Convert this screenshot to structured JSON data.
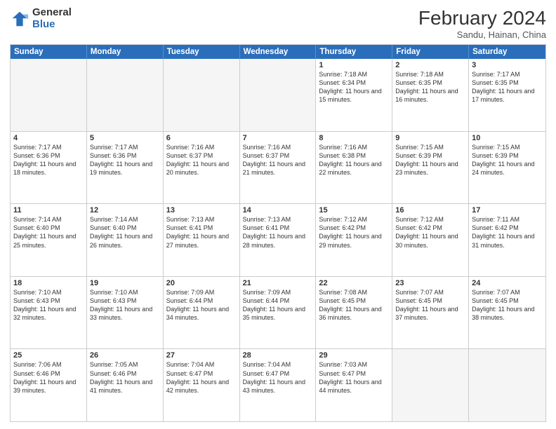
{
  "header": {
    "logo_general": "General",
    "logo_blue": "Blue",
    "month_year": "February 2024",
    "location": "Sandu, Hainan, China"
  },
  "days_of_week": [
    "Sunday",
    "Monday",
    "Tuesday",
    "Wednesday",
    "Thursday",
    "Friday",
    "Saturday"
  ],
  "weeks": [
    [
      {
        "day": "",
        "info": "",
        "empty": true
      },
      {
        "day": "",
        "info": "",
        "empty": true
      },
      {
        "day": "",
        "info": "",
        "empty": true
      },
      {
        "day": "",
        "info": "",
        "empty": true
      },
      {
        "day": "1",
        "info": "Sunrise: 7:18 AM\nSunset: 6:34 PM\nDaylight: 11 hours and 15 minutes."
      },
      {
        "day": "2",
        "info": "Sunrise: 7:18 AM\nSunset: 6:35 PM\nDaylight: 11 hours and 16 minutes."
      },
      {
        "day": "3",
        "info": "Sunrise: 7:17 AM\nSunset: 6:35 PM\nDaylight: 11 hours and 17 minutes."
      }
    ],
    [
      {
        "day": "4",
        "info": "Sunrise: 7:17 AM\nSunset: 6:36 PM\nDaylight: 11 hours and 18 minutes."
      },
      {
        "day": "5",
        "info": "Sunrise: 7:17 AM\nSunset: 6:36 PM\nDaylight: 11 hours and 19 minutes."
      },
      {
        "day": "6",
        "info": "Sunrise: 7:16 AM\nSunset: 6:37 PM\nDaylight: 11 hours and 20 minutes."
      },
      {
        "day": "7",
        "info": "Sunrise: 7:16 AM\nSunset: 6:37 PM\nDaylight: 11 hours and 21 minutes."
      },
      {
        "day": "8",
        "info": "Sunrise: 7:16 AM\nSunset: 6:38 PM\nDaylight: 11 hours and 22 minutes."
      },
      {
        "day": "9",
        "info": "Sunrise: 7:15 AM\nSunset: 6:39 PM\nDaylight: 11 hours and 23 minutes."
      },
      {
        "day": "10",
        "info": "Sunrise: 7:15 AM\nSunset: 6:39 PM\nDaylight: 11 hours and 24 minutes."
      }
    ],
    [
      {
        "day": "11",
        "info": "Sunrise: 7:14 AM\nSunset: 6:40 PM\nDaylight: 11 hours and 25 minutes."
      },
      {
        "day": "12",
        "info": "Sunrise: 7:14 AM\nSunset: 6:40 PM\nDaylight: 11 hours and 26 minutes."
      },
      {
        "day": "13",
        "info": "Sunrise: 7:13 AM\nSunset: 6:41 PM\nDaylight: 11 hours and 27 minutes."
      },
      {
        "day": "14",
        "info": "Sunrise: 7:13 AM\nSunset: 6:41 PM\nDaylight: 11 hours and 28 minutes."
      },
      {
        "day": "15",
        "info": "Sunrise: 7:12 AM\nSunset: 6:42 PM\nDaylight: 11 hours and 29 minutes."
      },
      {
        "day": "16",
        "info": "Sunrise: 7:12 AM\nSunset: 6:42 PM\nDaylight: 11 hours and 30 minutes."
      },
      {
        "day": "17",
        "info": "Sunrise: 7:11 AM\nSunset: 6:42 PM\nDaylight: 11 hours and 31 minutes."
      }
    ],
    [
      {
        "day": "18",
        "info": "Sunrise: 7:10 AM\nSunset: 6:43 PM\nDaylight: 11 hours and 32 minutes."
      },
      {
        "day": "19",
        "info": "Sunrise: 7:10 AM\nSunset: 6:43 PM\nDaylight: 11 hours and 33 minutes."
      },
      {
        "day": "20",
        "info": "Sunrise: 7:09 AM\nSunset: 6:44 PM\nDaylight: 11 hours and 34 minutes."
      },
      {
        "day": "21",
        "info": "Sunrise: 7:09 AM\nSunset: 6:44 PM\nDaylight: 11 hours and 35 minutes."
      },
      {
        "day": "22",
        "info": "Sunrise: 7:08 AM\nSunset: 6:45 PM\nDaylight: 11 hours and 36 minutes."
      },
      {
        "day": "23",
        "info": "Sunrise: 7:07 AM\nSunset: 6:45 PM\nDaylight: 11 hours and 37 minutes."
      },
      {
        "day": "24",
        "info": "Sunrise: 7:07 AM\nSunset: 6:45 PM\nDaylight: 11 hours and 38 minutes."
      }
    ],
    [
      {
        "day": "25",
        "info": "Sunrise: 7:06 AM\nSunset: 6:46 PM\nDaylight: 11 hours and 39 minutes."
      },
      {
        "day": "26",
        "info": "Sunrise: 7:05 AM\nSunset: 6:46 PM\nDaylight: 11 hours and 41 minutes."
      },
      {
        "day": "27",
        "info": "Sunrise: 7:04 AM\nSunset: 6:47 PM\nDaylight: 11 hours and 42 minutes."
      },
      {
        "day": "28",
        "info": "Sunrise: 7:04 AM\nSunset: 6:47 PM\nDaylight: 11 hours and 43 minutes."
      },
      {
        "day": "29",
        "info": "Sunrise: 7:03 AM\nSunset: 6:47 PM\nDaylight: 11 hours and 44 minutes."
      },
      {
        "day": "",
        "info": "",
        "empty": true
      },
      {
        "day": "",
        "info": "",
        "empty": true
      }
    ]
  ]
}
